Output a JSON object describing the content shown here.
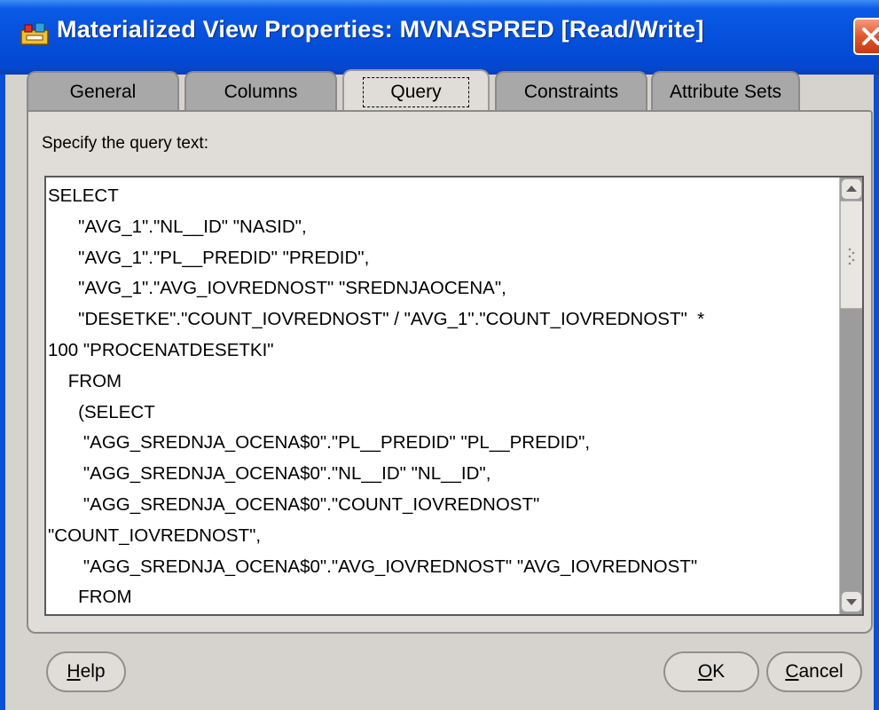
{
  "window": {
    "title": "Materialized View Properties: MVNASPRED [Read/Write]",
    "icons": {
      "app": "oracle-app-icon",
      "close": "close-icon"
    }
  },
  "tabs": [
    {
      "label": "General"
    },
    {
      "label": "Columns"
    },
    {
      "label": "Query",
      "active": true
    },
    {
      "label": "Constraints"
    },
    {
      "label": "Attribute Sets"
    }
  ],
  "panel": {
    "prompt": "Specify the query text:",
    "query_text": "SELECT\n      \"AVG_1\".\"NL__ID\" \"NASID\",\n      \"AVG_1\".\"PL__PREDID\" \"PREDID\",\n      \"AVG_1\".\"AVG_IOVREDNOST\" \"SREDNJAOCENA\",\n      \"DESETKE\".\"COUNT_IOVREDNOST\" / \"AVG_1\".\"COUNT_IOVREDNOST\"  *\n100 \"PROCENATDESETKI\"\n    FROM\n      (SELECT\n       \"AGG_SREDNJA_OCENA$0\".\"PL__PREDID\" \"PL__PREDID\",\n       \"AGG_SREDNJA_OCENA$0\".\"NL__ID\" \"NL__ID\",\n       \"AGG_SREDNJA_OCENA$0\".\"COUNT_IOVREDNOST\"\n\"COUNT_IOVREDNOST\",\n       \"AGG_SREDNJA_OCENA$0\".\"AVG_IOVREDNOST\" \"AVG_IOVREDNOST\"\n      FROM\n       (SELECT"
  },
  "buttons": {
    "help": {
      "mnemonic": "H",
      "rest": "elp"
    },
    "ok": {
      "mnemonic": "O",
      "rest": "K"
    },
    "cancel": {
      "mnemonic": "C",
      "rest": "ancel"
    }
  },
  "colors": {
    "titlebar": "#0550dc",
    "close_button": "#e2562d",
    "panel": "#e0ddd8",
    "inactive_tab": "#a8a8a8"
  }
}
